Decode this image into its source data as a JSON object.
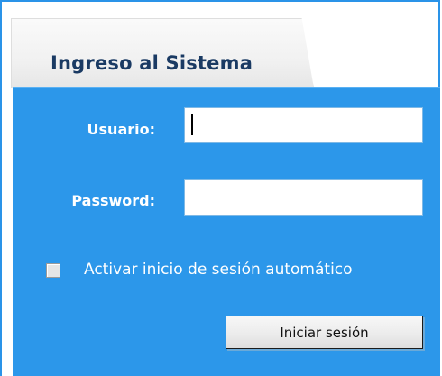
{
  "login": {
    "title": "Ingreso al Sistema",
    "username_label": "Usuario:",
    "username_value": "",
    "password_label": "Password:",
    "password_value": "",
    "remember_label": "Activar inicio de sesión automático",
    "remember_checked": false,
    "submit_label": "Iniciar sesión"
  },
  "colors": {
    "panel": "#2c97ea",
    "frame_border": "#2a93e8",
    "title_text": "#1a3a63"
  }
}
